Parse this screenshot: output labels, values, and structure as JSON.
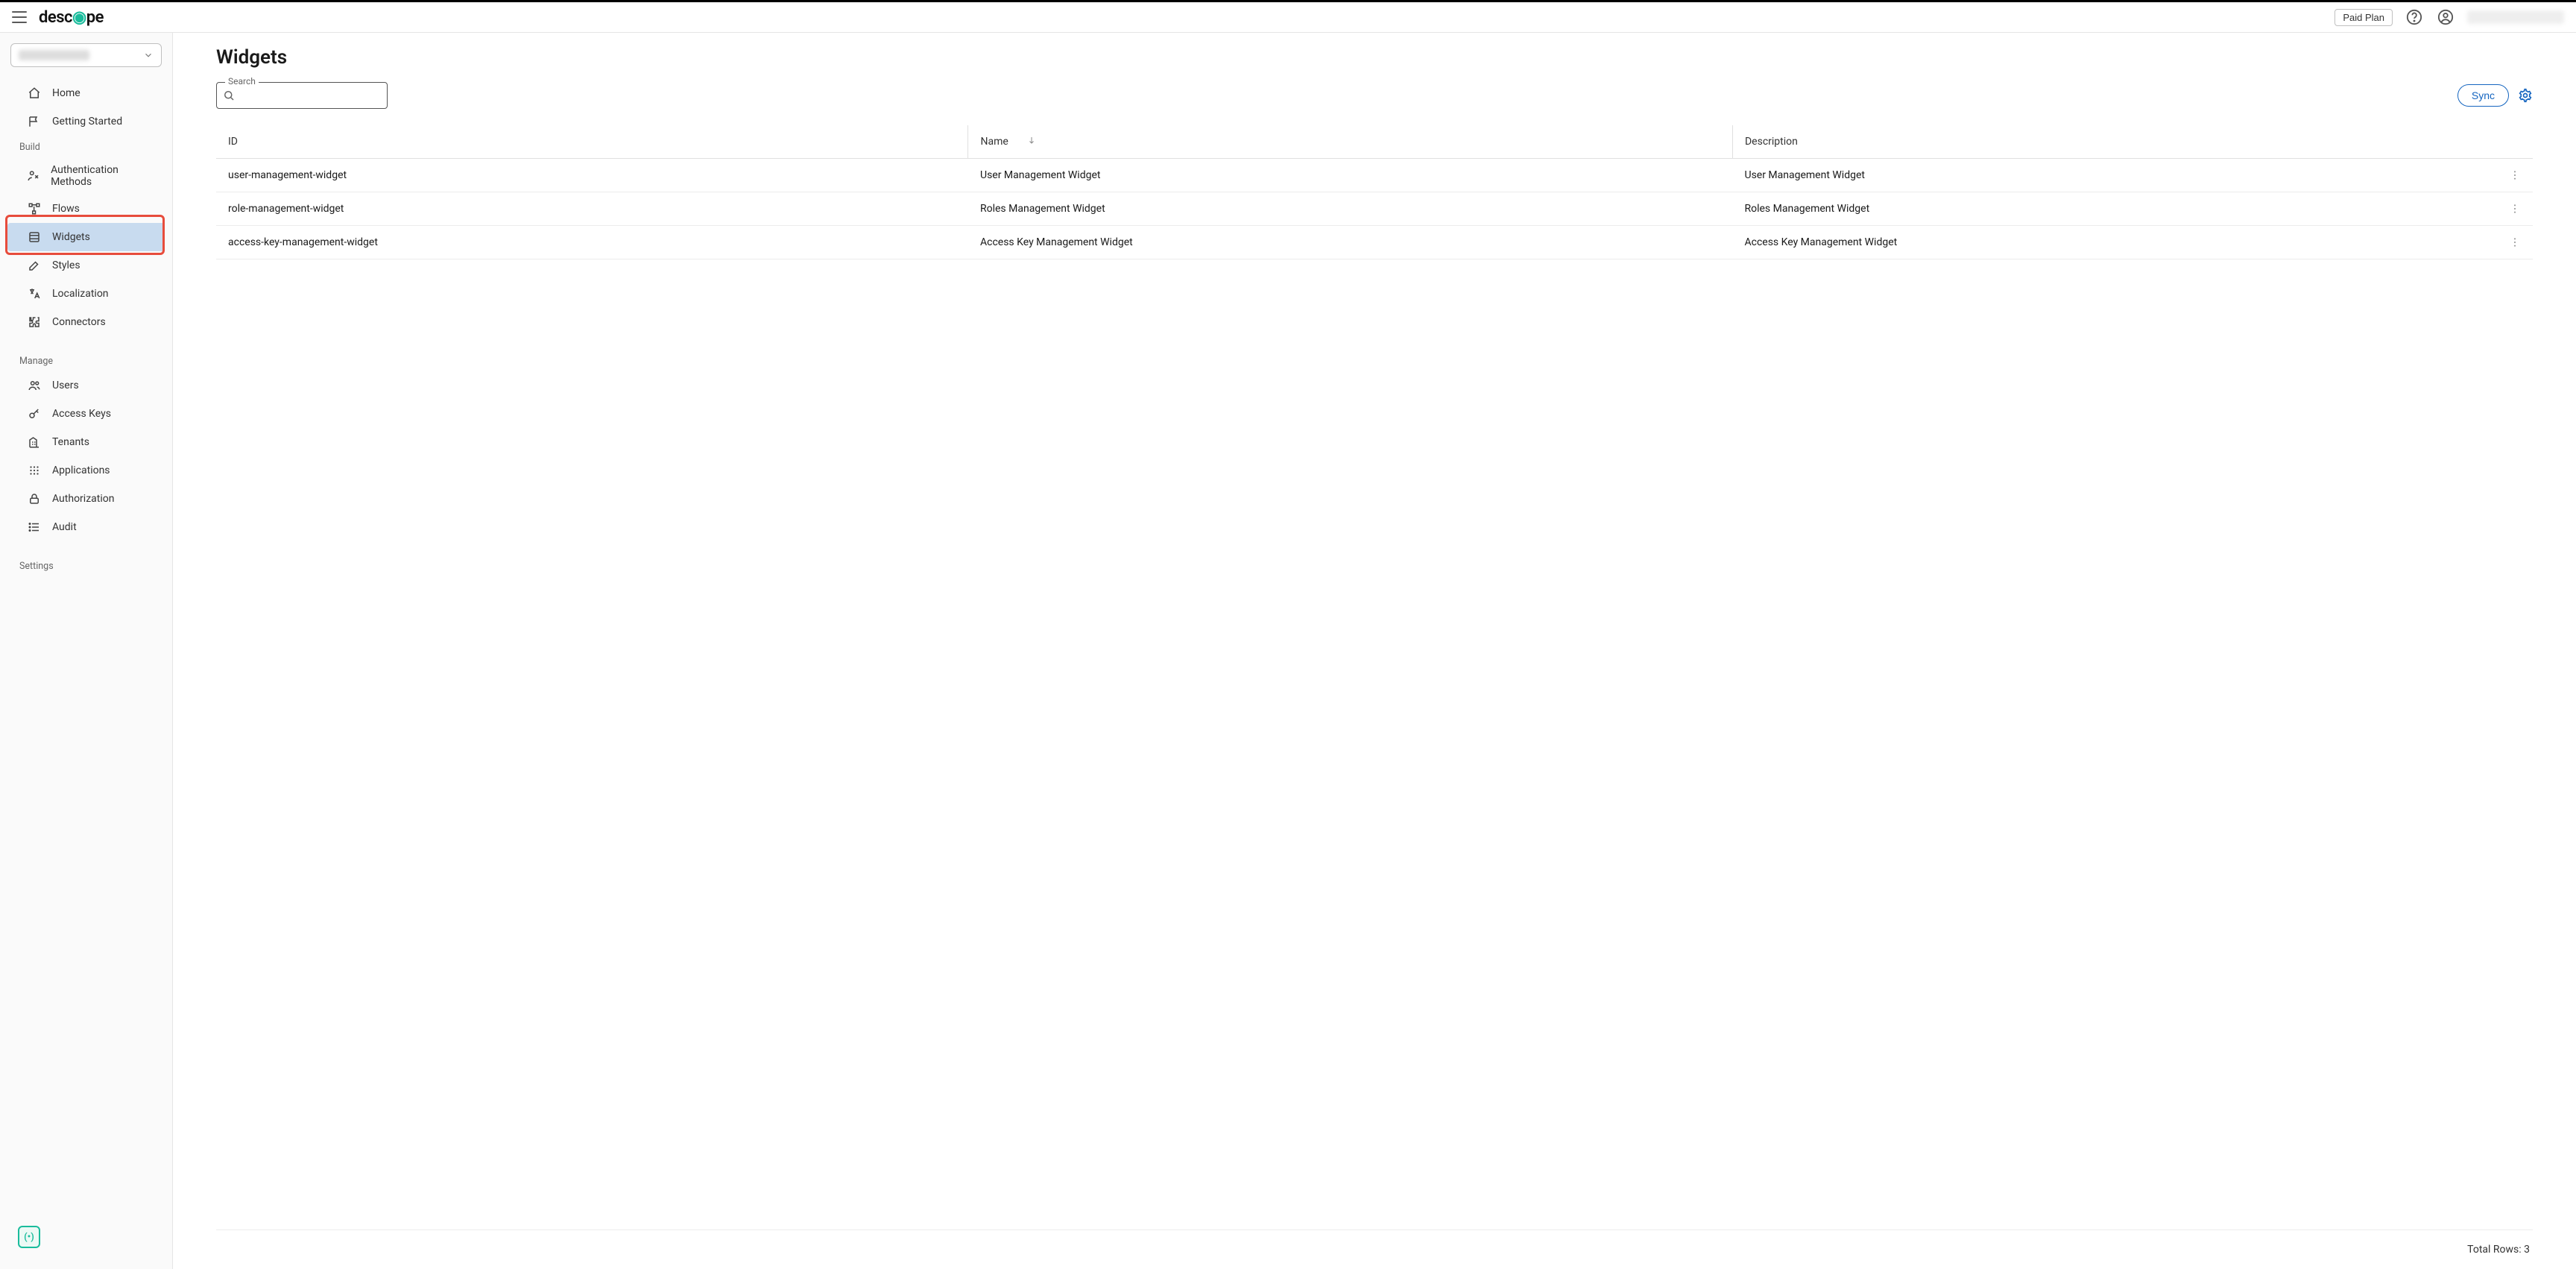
{
  "header": {
    "brand_left": "de",
    "brand_mid": "sc",
    "brand_o": "⦿",
    "brand_right": "pe",
    "plan_label": "Paid Plan"
  },
  "sidebar": {
    "items_top": [
      {
        "label": "Home"
      },
      {
        "label": "Getting Started"
      }
    ],
    "section_build": "Build",
    "items_build": [
      {
        "label": "Authentication Methods"
      },
      {
        "label": "Flows"
      },
      {
        "label": "Widgets",
        "active": true
      },
      {
        "label": "Styles"
      },
      {
        "label": "Localization"
      },
      {
        "label": "Connectors"
      }
    ],
    "section_manage": "Manage",
    "items_manage": [
      {
        "label": "Users"
      },
      {
        "label": "Access Keys"
      },
      {
        "label": "Tenants"
      },
      {
        "label": "Applications"
      },
      {
        "label": "Authorization"
      },
      {
        "label": "Audit"
      }
    ],
    "section_settings": "Settings"
  },
  "page": {
    "title": "Widgets",
    "search_label": "Search",
    "sync_label": "Sync"
  },
  "table": {
    "columns": {
      "id": "ID",
      "name": "Name",
      "desc": "Description"
    },
    "rows": [
      {
        "id": "user-management-widget",
        "name": "User Management Widget",
        "desc": "User Management Widget"
      },
      {
        "id": "role-management-widget",
        "name": "Roles Management Widget",
        "desc": "Roles Management Widget"
      },
      {
        "id": "access-key-management-widget",
        "name": "Access Key Management Widget",
        "desc": "Access Key Management Widget"
      }
    ]
  },
  "footer": {
    "total_label": "Total Rows: 3"
  }
}
